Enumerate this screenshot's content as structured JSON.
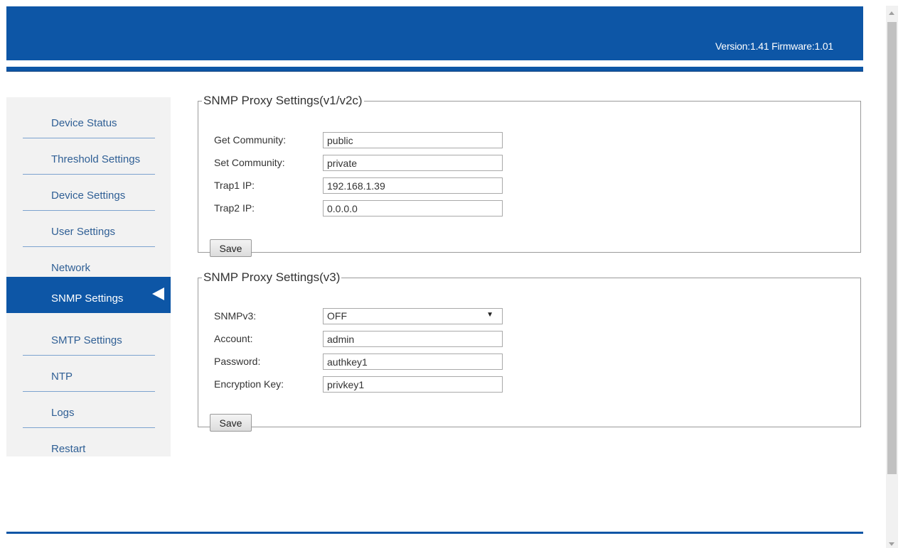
{
  "header": {
    "version_text": "Version:1.41 Firmware:1.01"
  },
  "sidebar": {
    "items": [
      {
        "label": "Device Status"
      },
      {
        "label": "Threshold Settings"
      },
      {
        "label": "Device Settings"
      },
      {
        "label": "User Settings"
      },
      {
        "label": "Network"
      },
      {
        "label": "SNMP Settings"
      },
      {
        "label": "SMTP Settings"
      },
      {
        "label": "NTP"
      },
      {
        "label": "Logs"
      },
      {
        "label": "Restart"
      }
    ],
    "active_item": "SNMP Settings"
  },
  "snmp_v1v2c": {
    "legend": "SNMP Proxy Settings(v1/v2c)",
    "get_community": {
      "label": "Get Community:",
      "value": "public"
    },
    "set_community": {
      "label": "Set Community:",
      "value": "private"
    },
    "trap1_ip": {
      "label": "Trap1 IP:",
      "value": "192.168.1.39"
    },
    "trap2_ip": {
      "label": "Trap2 IP:",
      "value": "0.0.0.0"
    },
    "save_label": "Save"
  },
  "snmp_v3": {
    "legend": "SNMP Proxy Settings(v3)",
    "snmpv3": {
      "label": "SNMPv3:",
      "value": "OFF"
    },
    "account": {
      "label": "Account:",
      "value": "admin"
    },
    "password": {
      "label": "Password:",
      "value": "authkey1"
    },
    "encryption_key": {
      "label": "Encryption Key:",
      "value": "privkey1"
    },
    "save_label": "Save"
  },
  "colors": {
    "brand_blue": "#0d56a6",
    "sidebar_bg": "#f2f2f2",
    "nav_text": "#2f5f95"
  }
}
